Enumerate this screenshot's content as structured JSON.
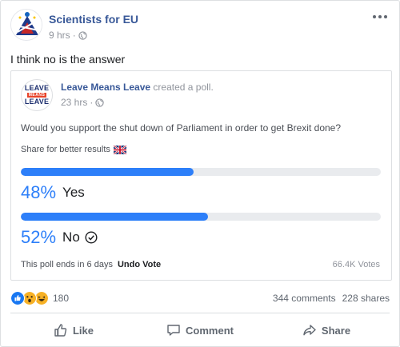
{
  "post": {
    "author": "Scientists for EU",
    "time": "9 hrs",
    "text": "I think no is the answer"
  },
  "shared": {
    "author": "Leave Means Leave",
    "verb": "created a poll.",
    "time": "23 hrs",
    "logo_lines": [
      "LEAVE",
      "MEANS",
      "LEAVE"
    ],
    "question": "Would you support the shut down of Parliament in order to get Brexit done?",
    "share_text": "Share for better results",
    "options": [
      {
        "percent": "48%",
        "label": "Yes",
        "fraction": 0.48,
        "voted": false
      },
      {
        "percent": "52%",
        "label": "No",
        "fraction": 0.52,
        "voted": true
      }
    ],
    "footer": {
      "ends": "This poll ends in 6 days",
      "undo": "Undo Vote",
      "votes": "66.4K Votes"
    }
  },
  "reactions": {
    "count": "180",
    "icons": [
      "like-icon",
      "wow-icon",
      "haha-icon"
    ],
    "comments": "344 comments",
    "shares": "228 shares"
  },
  "actions": {
    "like": "Like",
    "comment": "Comment",
    "share": "Share"
  },
  "colors": {
    "link": "#385898",
    "poll_blue": "#2d7ff9",
    "track": "#e9ebee",
    "muted": "#90949c"
  }
}
